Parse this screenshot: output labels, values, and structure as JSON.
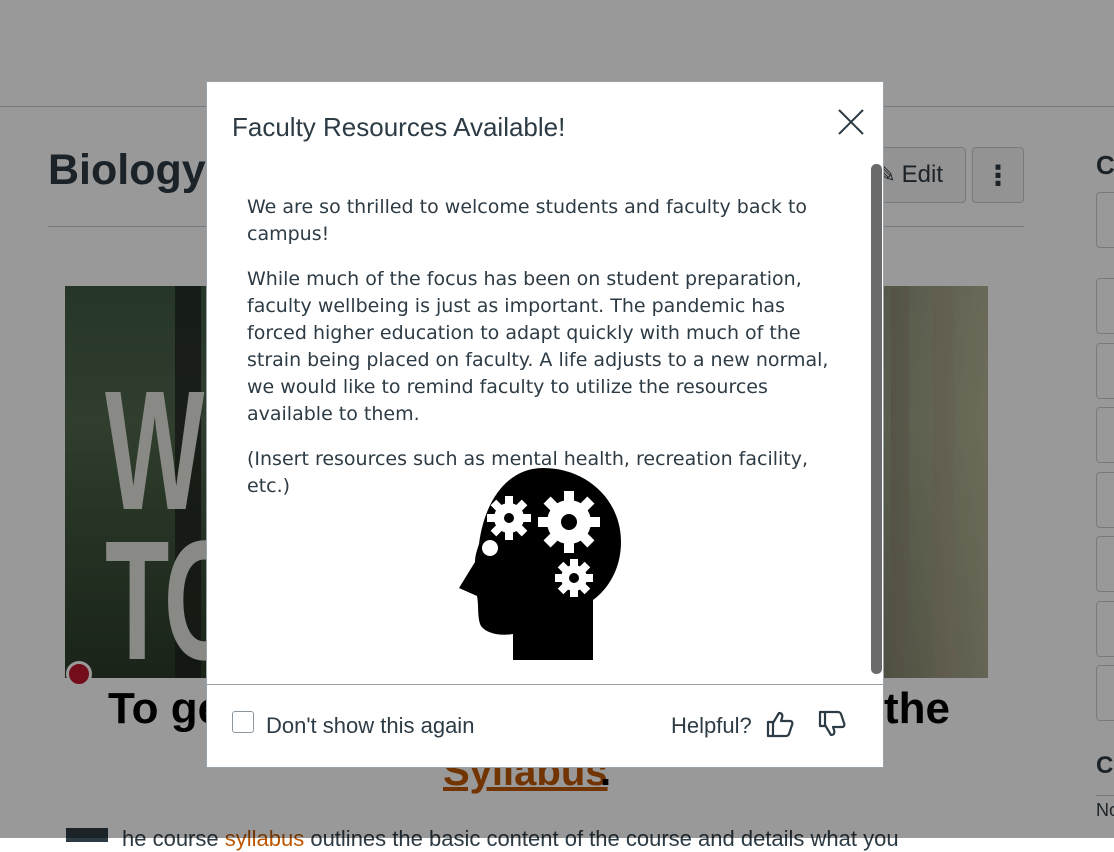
{
  "page": {
    "title": "Biology",
    "edit_label": "Edit",
    "more_label": "⋮",
    "banner_text_1": "W",
    "banner_text_2": "TO",
    "heading_left": "To ge",
    "heading_right": "the",
    "syllabus_link": "Syllabus",
    "syllabus_period": ".",
    "body_prefix": "he course ",
    "body_link": "syllabus",
    "body_suffix": " outlines the basic content of the course and details what you",
    "side_frag_1": "C",
    "side_frag_2": "C",
    "side_small": "No"
  },
  "modal": {
    "title": "Faculty Resources Available!",
    "paragraphs": [
      "We are so thrilled to welcome students and faculty back to campus!",
      "While much of the focus has been on student preparation, faculty wellbeing is just as important. The pandemic has forced higher education to adapt quickly with much of the strain being placed on faculty. A life adjusts to a new normal, we would like to remind faculty to utilize the resources available to them.",
      "(Insert resources such as mental health, recreation facility, etc.)"
    ],
    "image_icon": "head-gears-icon",
    "dont_show_label": "Don't show this again",
    "helpful_label": "Helpful?",
    "thumbs_up_icon": "thumbs-up-icon",
    "thumbs_down_icon": "thumbs-down-icon",
    "close_icon": "close-icon"
  },
  "colors": {
    "link": "#bf5700",
    "text": "#2d3b45",
    "overlay": "rgba(0,0,0,0.4)"
  }
}
